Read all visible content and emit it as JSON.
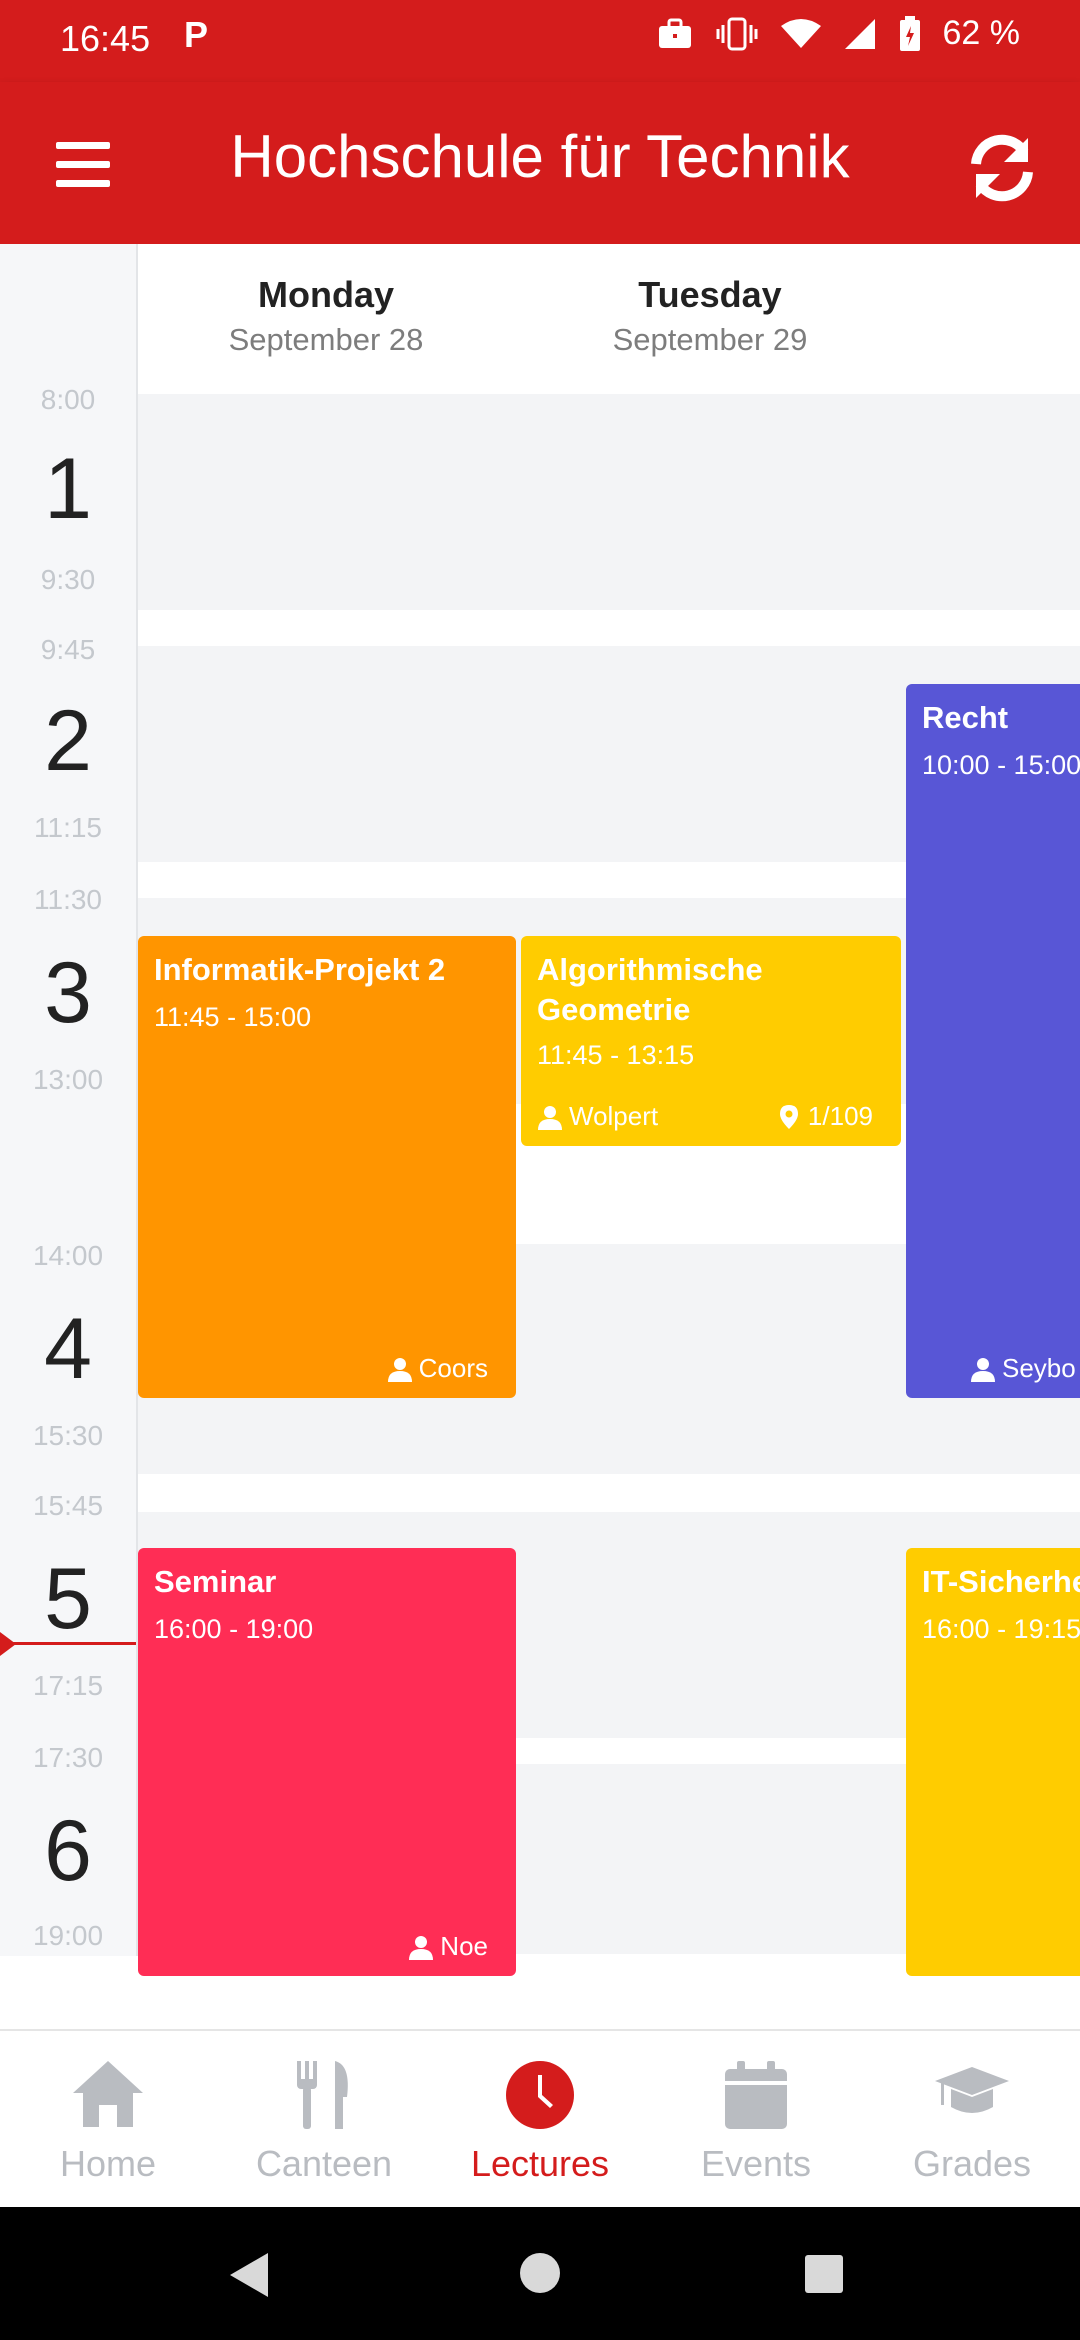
{
  "status_bar": {
    "time": "16:45",
    "indicator": "P",
    "battery": "62 %",
    "icons": [
      "briefcase-icon",
      "vibrate-icon",
      "wifi-icon",
      "signal-icon",
      "battery-icon"
    ]
  },
  "app_bar": {
    "title": "Hochschule für Technik",
    "menu_icon": "menu-icon",
    "refresh_icon": "refresh-icon"
  },
  "days": [
    {
      "name": "Monday",
      "date": "September 28"
    },
    {
      "name": "Tuesday",
      "date": "September 29"
    }
  ],
  "time_slots": [
    {
      "number": "1",
      "start": "8:00",
      "end": "9:30"
    },
    {
      "number": "2",
      "start": "9:45",
      "end": "11:15"
    },
    {
      "number": "3",
      "start": "11:30",
      "end": "13:00"
    },
    {
      "number": "4",
      "start": "14:00",
      "end": "15:30"
    },
    {
      "number": "5",
      "start": "15:45",
      "end": "17:15"
    },
    {
      "number": "6",
      "start": "17:30",
      "end": "19:00"
    }
  ],
  "events": [
    {
      "title": "Informatik-Projekt 2",
      "time": "11:45 - 15:00",
      "lecturer": "Coors",
      "room": "",
      "color": "#ff9500"
    },
    {
      "title_line1": "Algorithmische",
      "title_line2": "Geometrie",
      "time": "11:45 - 13:15",
      "lecturer": "Wolpert",
      "room": "1/109",
      "color": "#ffcc00"
    },
    {
      "title": "Recht",
      "time": "10:00 - 15:00",
      "lecturer": "Seybo",
      "room": "",
      "color": "#5856d6"
    },
    {
      "title": "Seminar",
      "time": "16:00 - 19:00",
      "lecturer": "Noe",
      "room": "",
      "color": "#ff2d55"
    },
    {
      "title": "IT-Sicherhe",
      "time": "16:00 - 19:15",
      "lecturer": "",
      "room": "",
      "color": "#ffcc00"
    }
  ],
  "bottom_nav": [
    {
      "label": "Home",
      "icon": "home-icon",
      "active": false
    },
    {
      "label": "Canteen",
      "icon": "cutlery-icon",
      "active": false
    },
    {
      "label": "Lectures",
      "icon": "clock-icon",
      "active": true
    },
    {
      "label": "Events",
      "icon": "calendar-icon",
      "active": false
    },
    {
      "label": "Grades",
      "icon": "graduation-cap-icon",
      "active": false
    }
  ],
  "colors": {
    "brand": "#d41c1c",
    "inactive_nav": "#b9bcc1"
  }
}
